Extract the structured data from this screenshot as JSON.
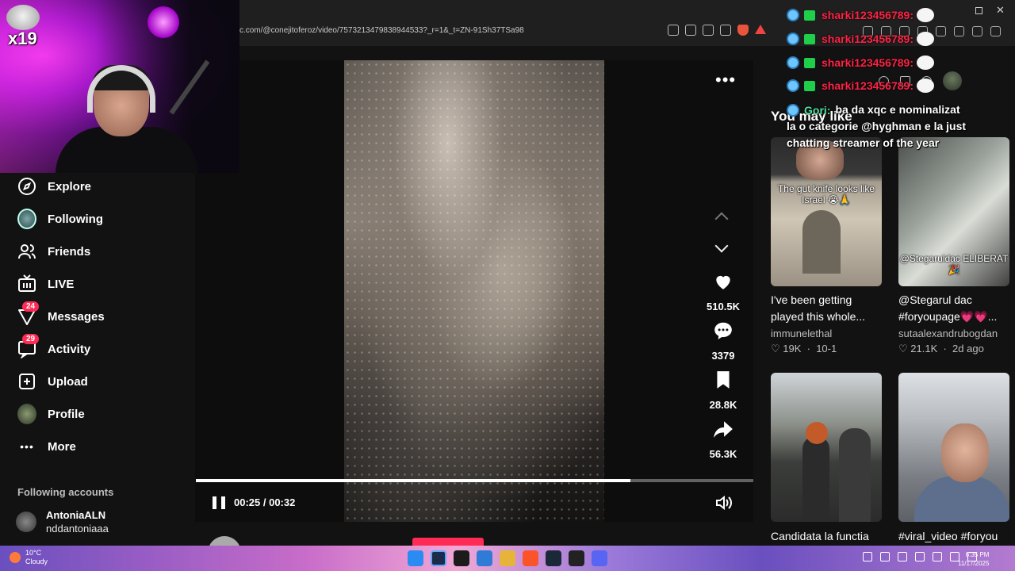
{
  "browser": {
    "url": "c.com/@conejitoferoz/video/7573213479838944533?_r=1&_t=ZN-91Sh37TSa98"
  },
  "stream_overlay": {
    "badge_multiplier": "x19"
  },
  "sidebar": {
    "items": [
      {
        "label": "Explore",
        "icon": "compass-icon"
      },
      {
        "label": "Following",
        "icon": "following-avatar-icon"
      },
      {
        "label": "Friends",
        "icon": "friends-icon"
      },
      {
        "label": "LIVE",
        "icon": "live-tv-icon"
      },
      {
        "label": "Messages",
        "icon": "send-icon",
        "count": "24"
      },
      {
        "label": "Activity",
        "icon": "message-bubble-icon",
        "count": "29"
      },
      {
        "label": "Upload",
        "icon": "plus-square-icon"
      },
      {
        "label": "Profile",
        "icon": "profile-avatar-icon"
      },
      {
        "label": "More",
        "icon": "ellipsis-icon"
      }
    ],
    "following_title": "Following accounts",
    "following": [
      {
        "name": "AntoniaALN",
        "handle": "nddantoniaaa"
      }
    ]
  },
  "video": {
    "likes": "510.5K",
    "comments": "3379",
    "saves": "28.8K",
    "shares": "56.3K",
    "time": "00:25 / 00:32",
    "progress": 0.78,
    "author": "conejitoferoz"
  },
  "recommendations": {
    "title": "You may like",
    "cards": [
      {
        "overlay_top": "The gut knife looks like Israel 😭🙏",
        "title": "I've been getting played this whole...",
        "author": "immunelethal",
        "likes": "19K",
        "date": "10-1"
      },
      {
        "overlay_bottom": "@Stegaruldac ELIBERAT 🎉",
        "title": "@Stegarul dac #foryoupage💗💗...",
        "author": "sutaalexandrubogdan",
        "likes": "21.1K",
        "date": "2d ago"
      },
      {
        "title": "Candidata la functia"
      },
      {
        "title": "#viral_video #foryou"
      }
    ]
  },
  "chat": {
    "lines": [
      {
        "user": "sharki123456789:"
      },
      {
        "user": "sharki123456789:"
      },
      {
        "user": "sharki123456789:"
      },
      {
        "user": "sharki123456789:"
      }
    ],
    "gori_user": "Gori:",
    "gori_msg_1": "ba da xqc e nominalizat",
    "gori_msg_2": "la o categorie @hyghman e la just",
    "gori_msg_3": "chatting streamer of the year"
  },
  "taskbar": {
    "temp": "10°C",
    "weather": "Cloudy",
    "time": "6:35 PM",
    "date": "11/17/2025"
  }
}
